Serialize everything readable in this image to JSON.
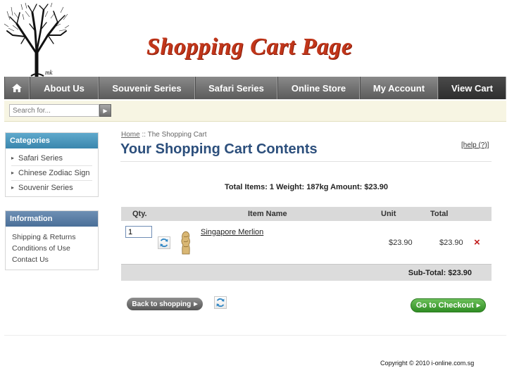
{
  "banner": {
    "title": "Shopping Cart Page"
  },
  "nav": {
    "items": [
      "About Us",
      "Souvenir Series",
      "Safari Series",
      "Online Store",
      "My Account",
      "View Cart"
    ],
    "active": "View Cart"
  },
  "search": {
    "placeholder": "Search for..."
  },
  "categories": {
    "title": "Categories",
    "items": [
      "Safari Series",
      "Chinese Zodiac Sign",
      "Souvenir Series"
    ]
  },
  "information": {
    "title": "Information",
    "items": [
      "Shipping & Returns",
      "Conditions of Use",
      "Contact Us"
    ]
  },
  "breadcrumb": {
    "home": "Home",
    "sep": "::",
    "current": "The Shopping Cart"
  },
  "cart": {
    "title": "Your Shopping Cart Contents",
    "help": "[help (?)]",
    "summary": "Total Items: 1  Weight: 187kg  Amount: $23.90",
    "columns": {
      "qty": "Qty.",
      "name": "Item Name",
      "unit": "Unit",
      "total": "Total"
    },
    "items": [
      {
        "qty": "1",
        "name": "Singapore Merlion",
        "unit": "$23.90",
        "total": "$23.90",
        "remove": "×"
      }
    ],
    "subtotal": "Sub-Total: $23.90"
  },
  "buttons": {
    "back": "Back to shopping",
    "checkout": "Go to Checkout"
  },
  "footer": {
    "copyright": "Copyright © 2010  i-online.com.sg"
  },
  "colors": {
    "nav": "#5b5b5b",
    "title": "#2c4f7c",
    "banner": "#c1361a",
    "checkout": "#2f8d23"
  }
}
